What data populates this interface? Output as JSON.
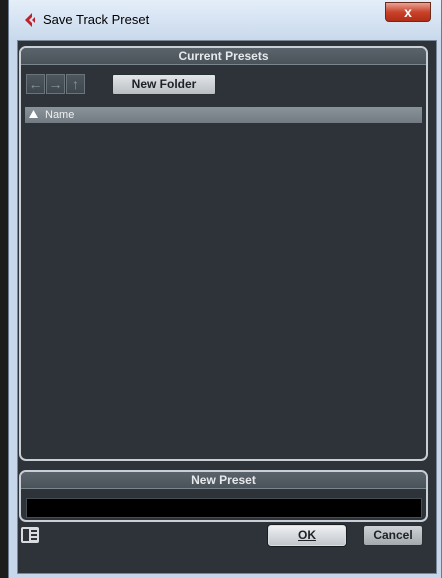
{
  "window": {
    "title": "Save Track Preset",
    "close_label": "x"
  },
  "presets": {
    "header": "Current Presets",
    "toolbar": {
      "back_glyph": "←",
      "forward_glyph": "→",
      "up_glyph": "↑",
      "new_folder_label": "New Folder"
    },
    "list": {
      "column_header": "Name",
      "sort_order": "ascending",
      "items": []
    }
  },
  "new_preset": {
    "header": "New Preset",
    "value": "",
    "placeholder": ""
  },
  "footer": {
    "ok_label": "OK",
    "cancel_label": "Cancel"
  },
  "colors": {
    "panel_bg": "#2d3338",
    "header_bg": "#5a636b",
    "accent_icon": "#c0202a"
  }
}
